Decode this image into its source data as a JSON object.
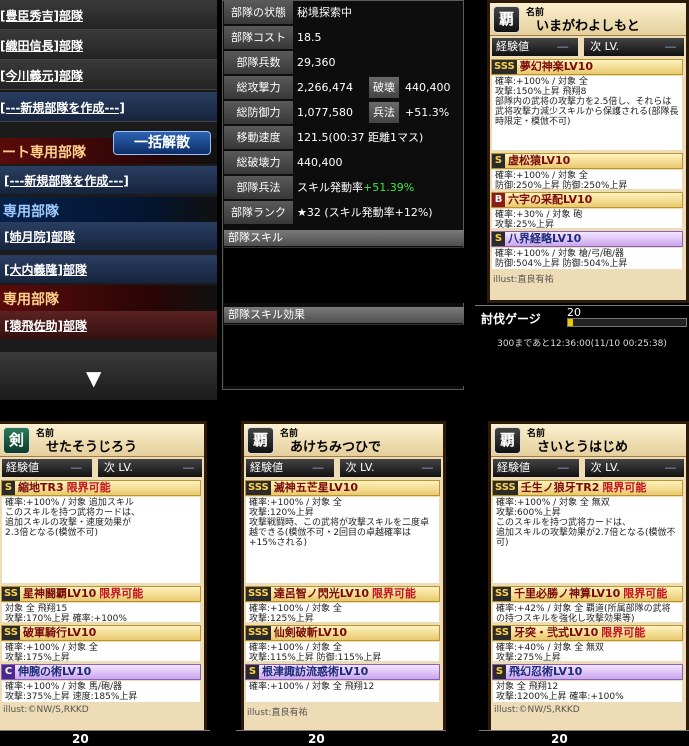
{
  "left_panel": {
    "decks_top": [
      "[豊臣秀吉]部隊",
      "[織田信長]部隊",
      "[今川義元]部隊"
    ],
    "new_deck_label": "[---新規部隊を作成---]",
    "release_all_button": "一括解散",
    "group_1_title": "ート専用部隊",
    "group_1_new": "[---新規部隊を作成---]",
    "group_2_title": "専用部隊",
    "group_2_decks": [
      "[姉月院]部隊",
      "[大内義隆]部隊"
    ],
    "group_3_title": "専用部隊",
    "group_3_decks": [
      "[猿飛佐助]部隊"
    ],
    "scroll_down_icon": "▼"
  },
  "stats": {
    "rows": [
      {
        "label": "部隊の状態",
        "value": "秘境探索中"
      },
      {
        "label": "部隊コスト",
        "value": "18.5"
      },
      {
        "label": "部隊兵数",
        "value": "29,360"
      },
      {
        "label": "総攻撃力",
        "value": "2,266,474",
        "label2": "破壊",
        "value2": "440,400"
      },
      {
        "label": "総防御力",
        "value": "1,077,580",
        "label2": "兵法",
        "value2": "+51.3%"
      },
      {
        "label": "移動速度",
        "value": "121.5(00:37 距離1マス)"
      },
      {
        "label": "総破壊力",
        "value": "440,400"
      },
      {
        "label": "部隊兵法",
        "value": "スキル発動率",
        "value_green": "+51.39%"
      },
      {
        "label": "部隊ランク",
        "value": "★32 (スキル発動率+12%)"
      }
    ],
    "section_skill": "部隊スキル",
    "section_skill_effect": "部隊スキル効果"
  },
  "cards": {
    "top_right": {
      "name_label": "名前",
      "name": "いまがわよしもと",
      "icon": "覇",
      "exp_label": "経験値",
      "exp_value": "―",
      "next_label": "次 LV.",
      "next_value": "―",
      "skills": [
        {
          "rank": "SSS",
          "name": "夢幻神楽LV10",
          "body": "確率:+100% / 対象 全\n攻撃:150%上昇 飛翔8\n部隊内の武将の攻撃力を2.5倍し、それらは武将攻撃力減少スキルから保護される(部隊長時限定・模倣不可)"
        },
        {
          "rank": "S",
          "name": "虚松猿LV10",
          "body": "確率:+100% / 対象 全\n防御:250%上昇 防御:250%上昇"
        },
        {
          "rank": "B",
          "name": "六字の采配LV10",
          "body": "確率:+30% / 対象 砲\n攻撃:25%上昇"
        },
        {
          "rank": "S",
          "name": "八界経略LV10",
          "body": "確率:+100% / 対象 槍/弓/砲/器\n防御:504%上昇 防御:504%上昇",
          "purple": true
        }
      ],
      "credit": "illust:直良有祐",
      "progress_label": "討伐ゲージ",
      "progress_value": "20",
      "progress_fraction": 0.04,
      "timer": "300まであと12:36:00(11/10 00:25:38)"
    },
    "bottom": [
      {
        "name_label": "名前",
        "name": "せたそうじろう",
        "icon": "剣",
        "exp_label": "経験値",
        "exp_value": "―",
        "next_label": "次 LV.",
        "next_value": "―",
        "skills": [
          {
            "rank": "S",
            "name": "縮地TR3",
            "limit": "限界可能",
            "body": "確率:+100% / 対象 追加スキル\nこのスキルを持つ武将カードは、\n追加スキルの攻撃・速度効果が\n2.3倍となる(模倣不可)"
          },
          {
            "rank": "SS",
            "name": "星神闘覇LV10",
            "limit": "限界可能",
            "body": "対象 全 飛翔15\n攻撃:170%上昇 確率:+100%"
          },
          {
            "rank": "SS",
            "name": "破軍騎行LV10",
            "body": "確率:+100% / 対象 全\n攻撃:175%上昇"
          },
          {
            "rank": "C",
            "name": "伸腕の術LV10",
            "body": "確率:+100% / 対象 馬/砲/器\n攻撃:375%上昇 速度:185%上昇",
            "purple": true
          }
        ],
        "credit": "illust:©NW/S,RKKD",
        "progress_value": "20"
      },
      {
        "name_label": "名前",
        "name": "あけちみつひで",
        "icon": "覇",
        "exp_label": "経験値",
        "exp_value": "―",
        "next_label": "次 LV.",
        "next_value": "―",
        "skills": [
          {
            "rank": "SSS",
            "name": "滅神五芒星LV10",
            "body": "確率:+100% / 対象 全\n攻撃:120%上昇\n攻撃戦闘時、この武将が攻撃スキルを二度卓越できる(模倣不可・2回目の卓越確率は+15%される)"
          },
          {
            "rank": "SSS",
            "name": "達呂智ノ閃光LV10",
            "limit": "限界可能",
            "body": "確率:+100% / 対象 全\n攻撃:125%上昇"
          },
          {
            "rank": "SSS",
            "name": "仙剣破斬LV10",
            "body": "確率:+100% / 対象 全\n攻撃:115%上昇 防御:115%上昇"
          },
          {
            "rank": "S",
            "name": "根津諏訪流惑術LV10",
            "body": "確率:+100% / 対象 全 飛翔12",
            "purple": true
          }
        ],
        "credit": "illust:直良有祐",
        "progress_value": "20"
      },
      {
        "name_label": "名前",
        "name": "さいとうはじめ",
        "icon": "覇",
        "exp_label": "経験値",
        "exp_value": "―",
        "next_label": "次 LV.",
        "next_value": "―",
        "skills": [
          {
            "rank": "SSS",
            "name": "壬生ノ狼牙TR2",
            "limit": "限界可能",
            "body": "確率:+100% / 対象 全 無双\n攻撃:600%上昇\nこのスキルを持つ武将カードは、\n追加スキルの攻撃効果が2.7倍となる(模倣不可)"
          },
          {
            "rank": "SS",
            "name": "千里必勝ノ神算LV10",
            "limit": "限界可能",
            "body": "確率:+42% / 対象 全 覇道(所属部隊の武将の持つスキルを強化し攻撃効果等)"
          },
          {
            "rank": "SS",
            "name": "牙突・弐式LV10",
            "limit": "限界可能",
            "body": "確率:+40% / 対象 全 無双\n攻撃:275%上昇"
          },
          {
            "rank": "S",
            "name": "飛幻忍術LV10",
            "body": "対象 全 飛翔12\n攻撃:1200%上昇 確率:+100%",
            "purple": true
          }
        ],
        "credit": "illust:©NW/S,RKKD",
        "progress_value": "20"
      }
    ]
  }
}
